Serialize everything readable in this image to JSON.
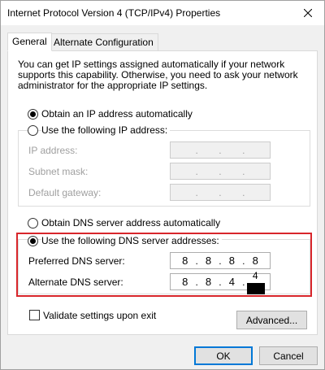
{
  "window": {
    "title": "Internet Protocol Version 4 (TCP/IPv4) Properties"
  },
  "tabs": [
    {
      "label": "General",
      "active": true
    },
    {
      "label": "Alternate Configuration",
      "active": false
    }
  ],
  "description": "You can get IP settings assigned automatically if your network supports this capability. Otherwise, you need to ask your network administrator for the appropriate IP settings.",
  "ip_section": {
    "auto_label": "Obtain an IP address automatically",
    "manual_label": "Use the following IP address:",
    "selected": "auto",
    "fields": [
      {
        "label": "IP address:",
        "octets": [
          "",
          "",
          "",
          ""
        ]
      },
      {
        "label": "Subnet mask:",
        "octets": [
          "",
          "",
          "",
          ""
        ]
      },
      {
        "label": "Default gateway:",
        "octets": [
          "",
          "",
          "",
          ""
        ]
      }
    ]
  },
  "dns_section": {
    "auto_label": "Obtain DNS server address automatically",
    "manual_label": "Use the following DNS server addresses:",
    "selected": "manual",
    "preferred": {
      "label": "Preferred DNS server:",
      "octets": [
        "8",
        "8",
        "8",
        "8"
      ]
    },
    "alternate": {
      "label": "Alternate DNS server:",
      "octets": [
        "8",
        "8",
        "4",
        "4"
      ]
    }
  },
  "validate": {
    "label": "Validate settings upon exit",
    "checked": false
  },
  "buttons": {
    "advanced": "Advanced...",
    "ok": "OK",
    "cancel": "Cancel"
  },
  "colors": {
    "highlight_border": "#d8262b",
    "default_button_border": "#0078d7"
  }
}
